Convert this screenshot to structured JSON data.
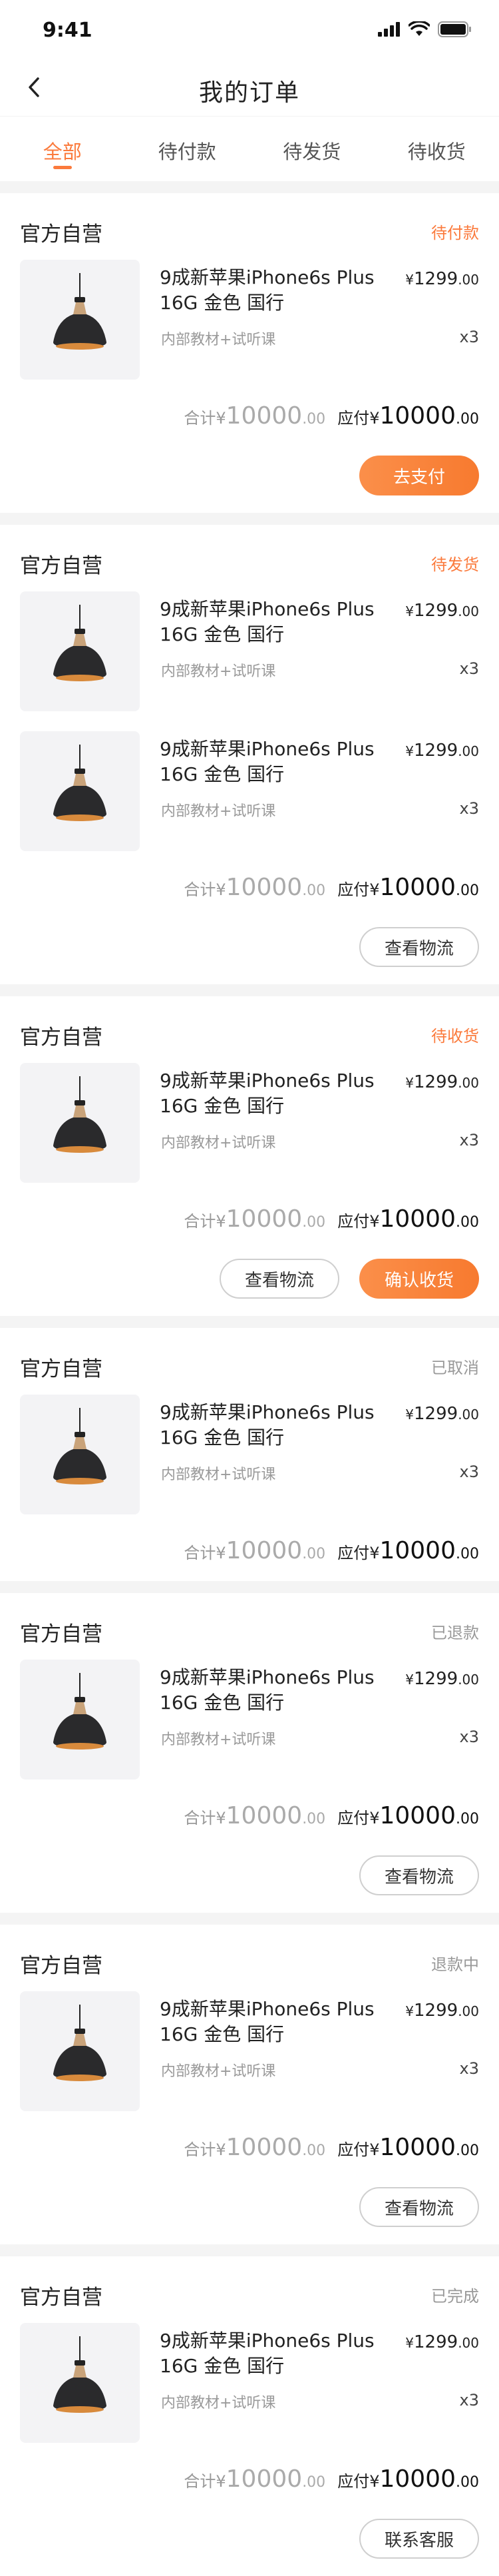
{
  "status_bar": {
    "time": "9:41"
  },
  "header": {
    "title": "我的订单",
    "back_icon": "chevron-left-icon"
  },
  "tabs": [
    {
      "label": "全部",
      "active": true
    },
    {
      "label": "待付款",
      "active": false
    },
    {
      "label": "待发货",
      "active": false
    },
    {
      "label": "待收货",
      "active": false
    }
  ],
  "colors": {
    "accent": "#fb7a3c",
    "muted": "#999999"
  },
  "orders": [
    {
      "shop": "官方自营",
      "status": "待付款",
      "status_tone": "orange",
      "items": [
        {
          "name": "9成新苹果iPhone6s Plus 16G 金色 国行",
          "price_main": "1299",
          "price_dec": ".00",
          "currency": "¥",
          "spec": "内部教材+试听课",
          "qty": "x3"
        }
      ],
      "total_label": "合计",
      "total_currency": "¥",
      "total_main": "10000",
      "total_dec": ".00",
      "pay_label": "应付",
      "pay_currency": "¥",
      "pay_main": "10000",
      "pay_dec": ".00",
      "buttons": [
        {
          "label": "去支付",
          "style": "solid"
        }
      ]
    },
    {
      "shop": "官方自营",
      "status": "待发货",
      "status_tone": "orange",
      "items": [
        {
          "name": "9成新苹果iPhone6s Plus 16G 金色 国行",
          "price_main": "1299",
          "price_dec": ".00",
          "currency": "¥",
          "spec": "内部教材+试听课",
          "qty": "x3"
        },
        {
          "name": "9成新苹果iPhone6s Plus 16G 金色 国行",
          "price_main": "1299",
          "price_dec": ".00",
          "currency": "¥",
          "spec": "内部教材+试听课",
          "qty": "x3"
        }
      ],
      "total_label": "合计",
      "total_currency": "¥",
      "total_main": "10000",
      "total_dec": ".00",
      "pay_label": "应付",
      "pay_currency": "¥",
      "pay_main": "10000",
      "pay_dec": ".00",
      "buttons": [
        {
          "label": "查看物流",
          "style": "outline"
        }
      ]
    },
    {
      "shop": "官方自营",
      "status": "待收货",
      "status_tone": "orange",
      "items": [
        {
          "name": "9成新苹果iPhone6s Plus 16G 金色 国行",
          "price_main": "1299",
          "price_dec": ".00",
          "currency": "¥",
          "spec": "内部教材+试听课",
          "qty": "x3"
        }
      ],
      "total_label": "合计",
      "total_currency": "¥",
      "total_main": "10000",
      "total_dec": ".00",
      "pay_label": "应付",
      "pay_currency": "¥",
      "pay_main": "10000",
      "pay_dec": ".00",
      "buttons": [
        {
          "label": "查看物流",
          "style": "outline"
        },
        {
          "label": "确认收货",
          "style": "solid"
        }
      ]
    },
    {
      "shop": "官方自营",
      "status": "已取消",
      "status_tone": "gray",
      "items": [
        {
          "name": "9成新苹果iPhone6s Plus 16G 金色 国行",
          "price_main": "1299",
          "price_dec": ".00",
          "currency": "¥",
          "spec": "内部教材+试听课",
          "qty": "x3"
        }
      ],
      "total_label": "合计",
      "total_currency": "¥",
      "total_main": "10000",
      "total_dec": ".00",
      "pay_label": "应付",
      "pay_currency": "¥",
      "pay_main": "10000",
      "pay_dec": ".00",
      "buttons": []
    },
    {
      "shop": "官方自营",
      "status": "已退款",
      "status_tone": "gray",
      "items": [
        {
          "name": "9成新苹果iPhone6s Plus 16G 金色 国行",
          "price_main": "1299",
          "price_dec": ".00",
          "currency": "¥",
          "spec": "内部教材+试听课",
          "qty": "x3"
        }
      ],
      "total_label": "合计",
      "total_currency": "¥",
      "total_main": "10000",
      "total_dec": ".00",
      "pay_label": "应付",
      "pay_currency": "¥",
      "pay_main": "10000",
      "pay_dec": ".00",
      "buttons": [
        {
          "label": "查看物流",
          "style": "outline"
        }
      ]
    },
    {
      "shop": "官方自营",
      "status": "退款中",
      "status_tone": "gray",
      "items": [
        {
          "name": "9成新苹果iPhone6s Plus 16G 金色 国行",
          "price_main": "1299",
          "price_dec": ".00",
          "currency": "¥",
          "spec": "内部教材+试听课",
          "qty": "x3"
        }
      ],
      "total_label": "合计",
      "total_currency": "¥",
      "total_main": "10000",
      "total_dec": ".00",
      "pay_label": "应付",
      "pay_currency": "¥",
      "pay_main": "10000",
      "pay_dec": ".00",
      "buttons": [
        {
          "label": "查看物流",
          "style": "outline"
        }
      ]
    },
    {
      "shop": "官方自营",
      "status": "已完成",
      "status_tone": "gray",
      "items": [
        {
          "name": "9成新苹果iPhone6s Plus 16G 金色 国行",
          "price_main": "1299",
          "price_dec": ".00",
          "currency": "¥",
          "spec": "内部教材+试听课",
          "qty": "x3"
        }
      ],
      "total_label": "合计",
      "total_currency": "¥",
      "total_main": "10000",
      "total_dec": ".00",
      "pay_label": "应付",
      "pay_currency": "¥",
      "pay_main": "10000",
      "pay_dec": ".00",
      "buttons": [
        {
          "label": "联系客服",
          "style": "outline"
        }
      ]
    }
  ]
}
